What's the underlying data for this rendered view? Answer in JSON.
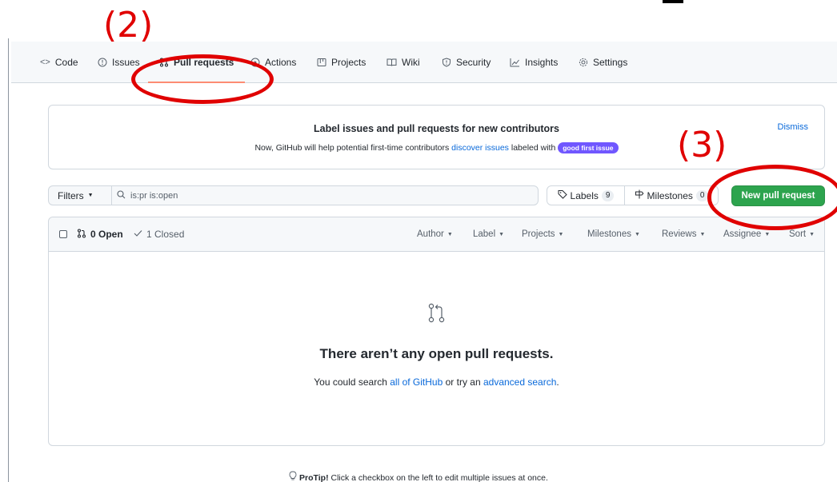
{
  "nav": {
    "tabs": [
      {
        "label": "Code",
        "icon": "code-icon",
        "glyph": "<>"
      },
      {
        "label": "Issues",
        "icon": "issue-icon",
        "glyph": "ⓘ"
      },
      {
        "label": "Pull requests",
        "icon": "pull-request-icon",
        "glyph": "⇅"
      },
      {
        "label": "Actions",
        "icon": "play-icon",
        "glyph": "⊙"
      },
      {
        "label": "Projects",
        "icon": "project-icon",
        "glyph": "▥"
      },
      {
        "label": "Wiki",
        "icon": "book-icon",
        "glyph": "◫"
      },
      {
        "label": "Security",
        "icon": "shield-icon",
        "glyph": "◯"
      },
      {
        "label": "Insights",
        "icon": "graph-icon",
        "glyph": "⟋"
      },
      {
        "label": "Settings",
        "icon": "gear-icon",
        "glyph": "⚙"
      }
    ],
    "active_tab": "Pull requests"
  },
  "banner": {
    "title": "Label issues and pull requests for new contributors",
    "text_before": "Now, GitHub will help potential first-time contributors ",
    "link": "discover issues",
    "text_after": " labeled with ",
    "pill": "good first issue",
    "dismiss": "Dismiss"
  },
  "toolbar": {
    "filters_label": "Filters",
    "search_value": "is:pr is:open",
    "labels_label": "Labels",
    "labels_count": "9",
    "milestones_label": "Milestones",
    "milestones_count": "0",
    "new_pr_label": "New pull request"
  },
  "list": {
    "open_label": "0 Open",
    "closed_label": "1 Closed",
    "filters": [
      "Author",
      "Label",
      "Projects",
      "Milestones",
      "Reviews",
      "Assignee",
      "Sort"
    ],
    "empty_title": "There aren’t any open pull requests.",
    "empty_text_1": "You could search ",
    "empty_link_1": "all of GitHub",
    "empty_text_2": " or try an ",
    "empty_link_2": "advanced search",
    "empty_text_3": "."
  },
  "protip": {
    "label": "ProTip!",
    "text": " Click a checkbox on the left to edit multiple issues at once."
  },
  "annotations": {
    "step2": "(2)",
    "step3": "(3)",
    "color": "#e00000"
  },
  "colors": {
    "accent": "#0969da",
    "primary_button": "#2da44e",
    "tab_underline": "#fd8c73",
    "label_pill": "#7057ff"
  }
}
